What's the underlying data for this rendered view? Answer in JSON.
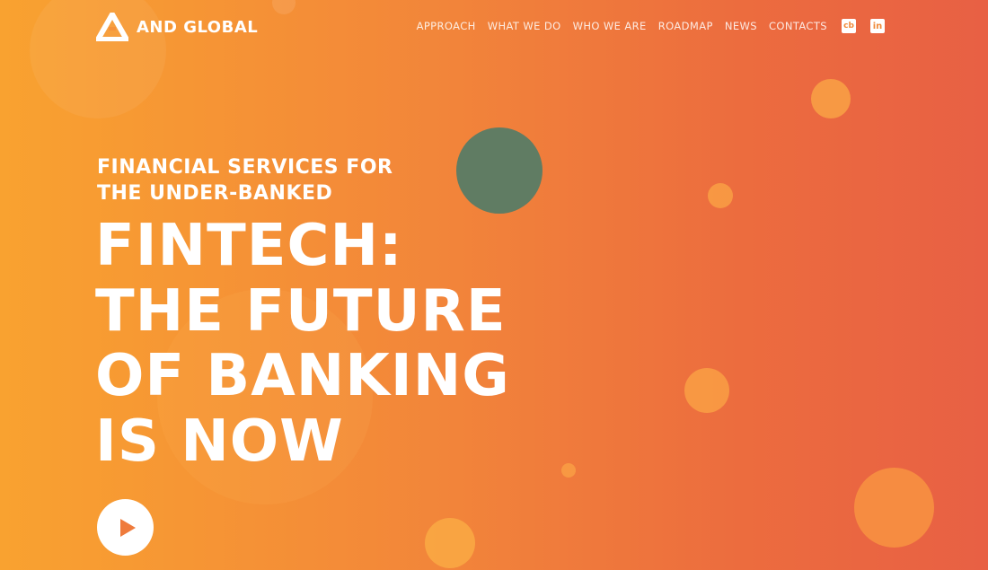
{
  "brand": {
    "name": "AND GLOBAL",
    "logo_icon": "triangle-logo-icon"
  },
  "nav": {
    "items": [
      "APPROACH",
      "WHAT WE DO",
      "WHO WE ARE",
      "ROADMAP",
      "NEWS",
      "CONTACTS"
    ],
    "social": [
      {
        "label": "cb",
        "icon": "crunchbase-icon"
      },
      {
        "label": "in",
        "icon": "linkedin-icon"
      }
    ]
  },
  "hero": {
    "subtitle_line1": "FINANCIAL SERVICES FOR",
    "subtitle_line2": "THE UNDER-BANKED",
    "title_lines": [
      "FINTECH:",
      "THE FUTURE",
      "OF BANKING",
      "IS NOW"
    ],
    "play_icon": "play-icon"
  },
  "colors": {
    "gradient_start": "#f9a230",
    "gradient_end": "#e86044",
    "accent_circle": "#607c63",
    "text": "#ffffff"
  }
}
